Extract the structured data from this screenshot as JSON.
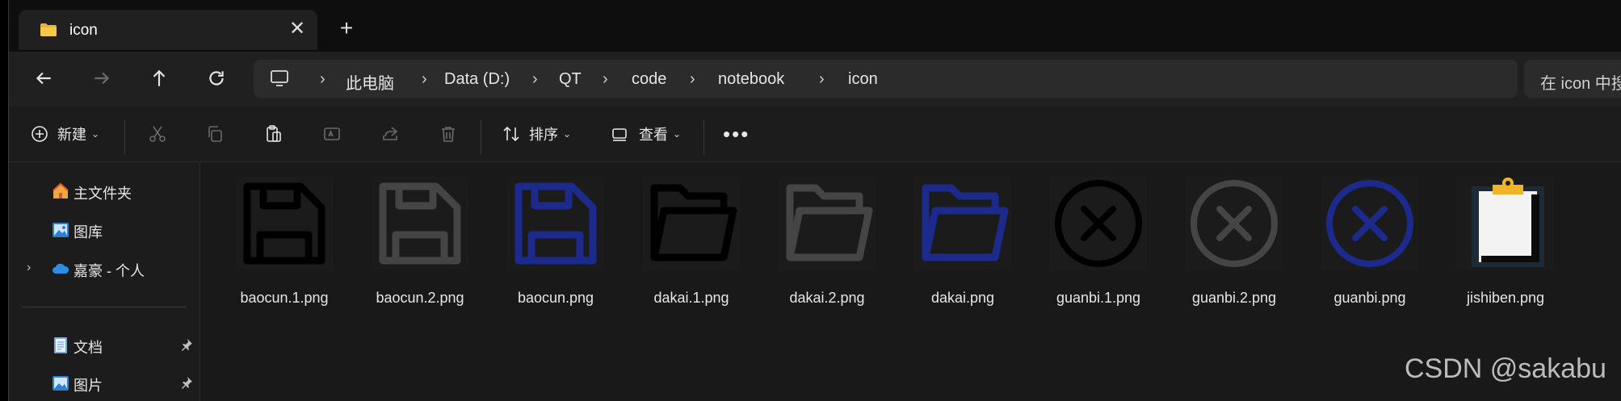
{
  "tab": {
    "title": "icon",
    "close_icon": "close-icon",
    "new_tab_icon": "plus-icon"
  },
  "nav": {
    "back": "arrow-left-icon",
    "forward": "arrow-right-icon",
    "up": "arrow-up-icon",
    "refresh": "refresh-icon"
  },
  "breadcrumb": [
    "此电脑",
    "Data (D:)",
    "QT",
    "code",
    "notebook",
    "icon"
  ],
  "search": {
    "placeholder": "在 icon 中搜"
  },
  "command_bar": {
    "new_label": "新建",
    "sort_label": "排序",
    "view_label": "查看",
    "more_icon": "ellipsis-icon"
  },
  "sidebar": {
    "items": [
      {
        "label": "主文件夹",
        "icon": "home-icon"
      },
      {
        "label": "图库",
        "icon": "gallery-icon"
      },
      {
        "label": "嘉豪 - 个人",
        "icon": "onedrive-icon"
      },
      {
        "label": "文档",
        "icon": "document-icon",
        "pinned": true
      },
      {
        "label": "图片",
        "icon": "pictures-icon",
        "pinned": true
      }
    ]
  },
  "files": [
    {
      "name": "baocun.1.png",
      "icon": "save-icon",
      "color": "#000000"
    },
    {
      "name": "baocun.2.png",
      "icon": "save-icon",
      "color": "#454545"
    },
    {
      "name": "baocun.png",
      "icon": "save-icon",
      "color": "#1c2a8c"
    },
    {
      "name": "dakai.1.png",
      "icon": "folder-open-icon",
      "color": "#000000"
    },
    {
      "name": "dakai.2.png",
      "icon": "folder-open-icon",
      "color": "#454545"
    },
    {
      "name": "dakai.png",
      "icon": "folder-open-icon",
      "color": "#1c2a8c"
    },
    {
      "name": "guanbi.1.png",
      "icon": "close-circle-icon",
      "color": "#000000"
    },
    {
      "name": "guanbi.2.png",
      "icon": "close-circle-icon",
      "color": "#454545"
    },
    {
      "name": "guanbi.png",
      "icon": "close-circle-icon",
      "color": "#1c2a8c"
    },
    {
      "name": "jishiben.png",
      "icon": "clipboard-icon",
      "color": "#f3f3f3"
    }
  ],
  "watermark": "CSDN @sakabu"
}
